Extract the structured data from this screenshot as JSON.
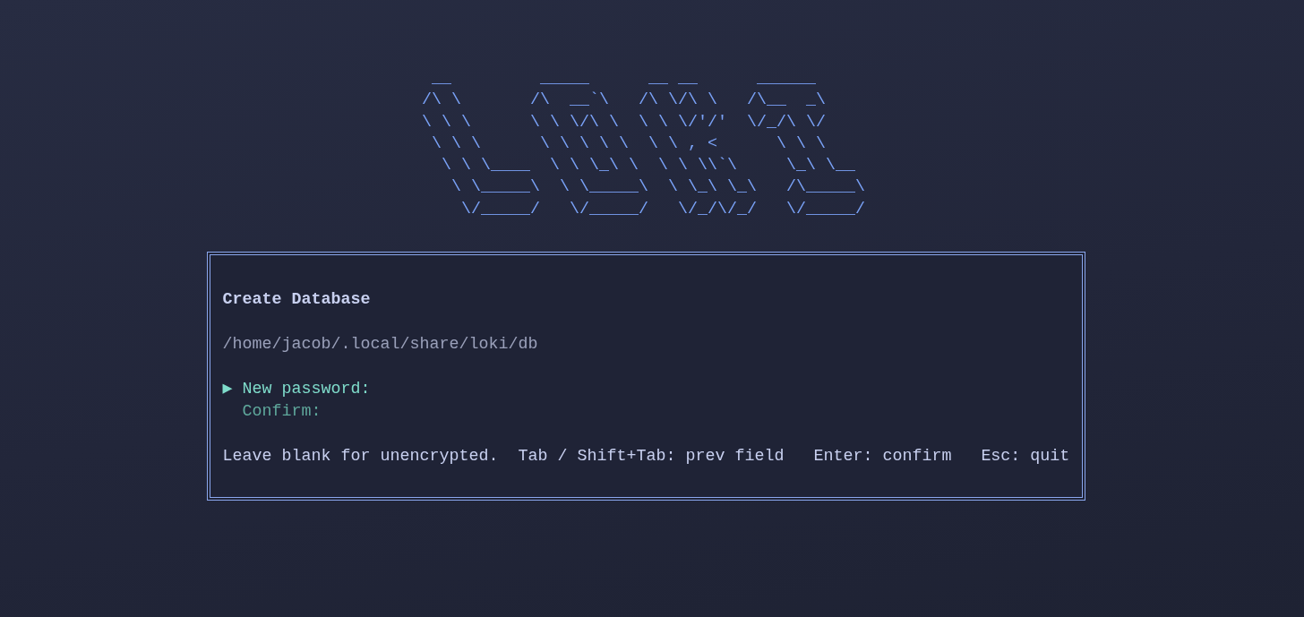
{
  "logo": {
    "lines": [
      " __         _____      __ __      ______",
      "/\\ \\       /\\  __`\\   /\\ \\/\\ \\   /\\__  _\\",
      "\\ \\ \\      \\ \\ \\/\\ \\  \\ \\ \\/'/'  \\/_/\\ \\/",
      " \\ \\ \\      \\ \\ \\ \\ \\  \\ \\ , <      \\ \\ \\",
      "  \\ \\ \\____  \\ \\ \\_\\ \\  \\ \\ \\\\`\\     \\_\\ \\__",
      "   \\ \\_____\\  \\ \\_____\\  \\ \\_\\ \\_\\   /\\_____\\",
      "    \\/_____/   \\/_____/   \\/_/\\/_/   \\/_____/"
    ]
  },
  "dialog": {
    "title": "Create Database",
    "path": "/home/jacob/.local/share/loki/db",
    "marker": "▶",
    "fields": [
      {
        "label": "New password:",
        "selected": true
      },
      {
        "label": "Confirm:",
        "selected": false
      }
    ],
    "hints": [
      "Leave blank for unencrypted.",
      "Tab / Shift+Tab: prev field",
      "Enter: confirm",
      "Esc: quit"
    ]
  }
}
